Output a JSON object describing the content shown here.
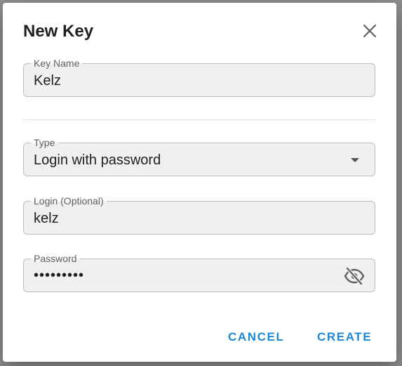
{
  "dialog": {
    "title": "New Key",
    "close_icon": "close-icon"
  },
  "fields": {
    "key_name": {
      "label": "Key Name",
      "value": "Kelz"
    },
    "type": {
      "label": "Type",
      "value": "Login with password",
      "icon": "dropdown-arrow-icon"
    },
    "login": {
      "label": "Login (Optional)",
      "value": "kelz"
    },
    "password": {
      "label": "Password",
      "value": "•••••••••",
      "icon": "eye-off-icon"
    }
  },
  "actions": {
    "cancel_label": "CANCEL",
    "create_label": "CREATE"
  },
  "colors": {
    "accent": "#1e88d8",
    "backdrop": "#8f8f8f",
    "field_bg": "#f0f0f0"
  }
}
